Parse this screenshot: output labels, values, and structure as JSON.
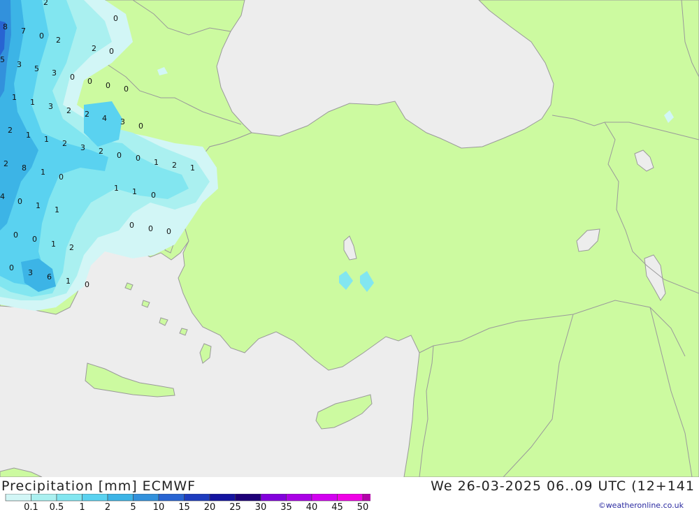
{
  "header": {
    "title": "Precipitation [mm] ECMWF",
    "timestamp": "We 26-03-2025 06..09 UTC (12+141"
  },
  "legend": {
    "ticks": [
      "0.1",
      "0.5",
      "1",
      "2",
      "5",
      "10",
      "15",
      "20",
      "25",
      "30",
      "35",
      "40",
      "45",
      "50"
    ],
    "colors": [
      "#d2f6f6",
      "#aaf0f0",
      "#82e6f0",
      "#5ad2f0",
      "#3cb4e6",
      "#3291dc",
      "#2864d2",
      "#1e3cbe",
      "#1414a0",
      "#1e0078",
      "#8200dc",
      "#aa00e6",
      "#d200f0",
      "#f000e6",
      "#b400aa"
    ]
  },
  "credit": "©weatheronline.co.uk",
  "colors": {
    "sea": "#ededed",
    "land": "#ccfaa0",
    "border": "#9a9a9a"
  },
  "map": {
    "labels": [
      {
        "id": "l1",
        "t": "2"
      },
      {
        "id": "l2",
        "t": "0"
      },
      {
        "id": "l3",
        "t": "8"
      },
      {
        "id": "l4",
        "t": "7"
      },
      {
        "id": "l5",
        "t": "0"
      },
      {
        "id": "l6",
        "t": "2"
      },
      {
        "id": "l7",
        "t": "2"
      },
      {
        "id": "l8",
        "t": "0"
      },
      {
        "id": "l9",
        "t": "5"
      },
      {
        "id": "l10",
        "t": "3"
      },
      {
        "id": "l11",
        "t": "5"
      },
      {
        "id": "l12",
        "t": "3"
      },
      {
        "id": "l13",
        "t": "0"
      },
      {
        "id": "l14",
        "t": "0"
      },
      {
        "id": "l15",
        "t": "0"
      },
      {
        "id": "l16",
        "t": "0"
      },
      {
        "id": "l17",
        "t": "1"
      },
      {
        "id": "l18",
        "t": "1"
      },
      {
        "id": "l19",
        "t": "3"
      },
      {
        "id": "l20",
        "t": "2"
      },
      {
        "id": "l21",
        "t": "2"
      },
      {
        "id": "l22",
        "t": "4"
      },
      {
        "id": "l23",
        "t": "3"
      },
      {
        "id": "l24",
        "t": "0"
      },
      {
        "id": "l25",
        "t": "2"
      },
      {
        "id": "l26",
        "t": "1"
      },
      {
        "id": "l27",
        "t": "1"
      },
      {
        "id": "l28",
        "t": "2"
      },
      {
        "id": "l29",
        "t": "3"
      },
      {
        "id": "l30",
        "t": "2"
      },
      {
        "id": "l31",
        "t": "0"
      },
      {
        "id": "l32",
        "t": "0"
      },
      {
        "id": "l33",
        "t": "1"
      },
      {
        "id": "l34",
        "t": "2"
      },
      {
        "id": "l35",
        "t": "1"
      },
      {
        "id": "l36",
        "t": "2"
      },
      {
        "id": "l37",
        "t": "8"
      },
      {
        "id": "l38",
        "t": "1"
      },
      {
        "id": "l39",
        "t": "0"
      },
      {
        "id": "l40",
        "t": "1"
      },
      {
        "id": "l41",
        "t": "1"
      },
      {
        "id": "l42",
        "t": "0"
      },
      {
        "id": "l43",
        "t": "4"
      },
      {
        "id": "l44",
        "t": "0"
      },
      {
        "id": "l45",
        "t": "1"
      },
      {
        "id": "l46",
        "t": "1"
      },
      {
        "id": "l47",
        "t": "0"
      },
      {
        "id": "l48",
        "t": "0"
      },
      {
        "id": "l49",
        "t": "0"
      },
      {
        "id": "l50",
        "t": "0"
      },
      {
        "id": "l51",
        "t": "0"
      },
      {
        "id": "l52",
        "t": "1"
      },
      {
        "id": "l53",
        "t": "2"
      },
      {
        "id": "l54",
        "t": "0"
      },
      {
        "id": "l55",
        "t": "3"
      },
      {
        "id": "l56",
        "t": "6"
      },
      {
        "id": "l57",
        "t": "1"
      },
      {
        "id": "l58",
        "t": "0"
      }
    ]
  }
}
